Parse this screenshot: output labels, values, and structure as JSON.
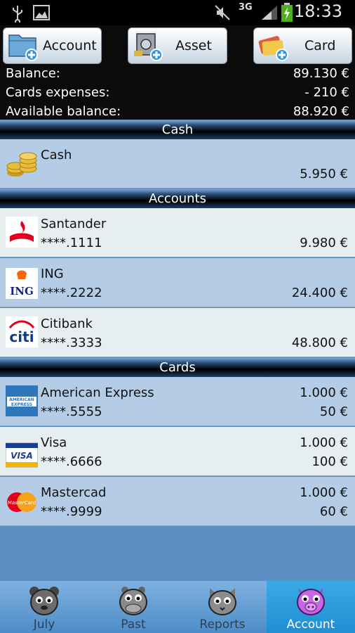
{
  "status_bar": {
    "time": "18:33",
    "network": "3G",
    "icons": [
      "usb-icon",
      "image-icon",
      "mute-icon",
      "signal-icon",
      "battery-charging-icon"
    ]
  },
  "toolbar": {
    "account_label": "Account",
    "asset_label": "Asset",
    "card_label": "Card"
  },
  "summary": {
    "balance_label": "Balance:",
    "balance_value": "89.130 €",
    "cards_expenses_label": "Cards expenses:",
    "cards_expenses_value": "- 210 €",
    "available_label": "Available balance:",
    "available_value": "88.920 €"
  },
  "sections": {
    "cash": "Cash",
    "accounts": "Accounts",
    "cards": "Cards"
  },
  "cash": [
    {
      "name": "Cash",
      "value": "5.950 €",
      "icon": "coins-icon"
    }
  ],
  "accounts": [
    {
      "name": "Santander",
      "number": "****.1111",
      "value": "9.980 €",
      "icon": "santander-logo-icon"
    },
    {
      "name": "ING",
      "number": "****.2222",
      "value": "24.400 €",
      "icon": "ing-logo-icon"
    },
    {
      "name": "Citibank",
      "number": "****.3333",
      "value": "48.800 €",
      "icon": "citi-logo-icon"
    }
  ],
  "cards": [
    {
      "name": "American Express",
      "number": "****.5555",
      "limit": "1.000 €",
      "spent": "50 €",
      "icon": "amex-logo-icon"
    },
    {
      "name": "Visa",
      "number": "****.6666",
      "limit": "1.000 €",
      "spent": "100 €",
      "icon": "visa-logo-icon"
    },
    {
      "name": "Mastercad",
      "number": "****.9999",
      "limit": "1.000 €",
      "spent": "60 €",
      "icon": "mastercard-logo-icon"
    }
  ],
  "logo_text": {
    "ing": "ING",
    "citi": "citi",
    "amex_line1": "AMERICAN",
    "amex_line2": "EXPRESS",
    "visa": "VISA",
    "mastercard": "MasterCard"
  },
  "tabs": [
    {
      "label": "July",
      "active": false
    },
    {
      "label": "Past",
      "active": false
    },
    {
      "label": "Reports",
      "active": false
    },
    {
      "label": "Account",
      "active": true
    }
  ]
}
